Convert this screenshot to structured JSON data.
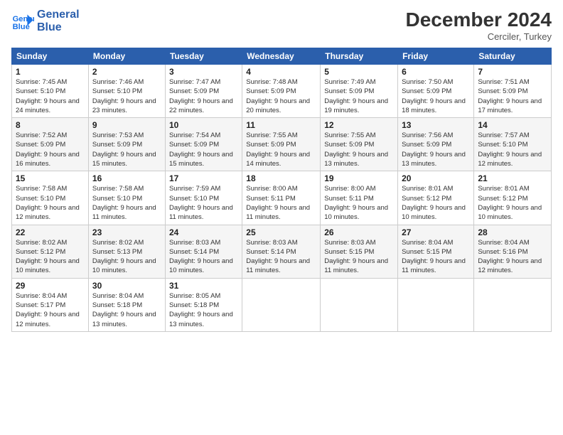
{
  "header": {
    "logo_line1": "General",
    "logo_line2": "Blue",
    "month": "December 2024",
    "location": "Cerciler, Turkey"
  },
  "weekdays": [
    "Sunday",
    "Monday",
    "Tuesday",
    "Wednesday",
    "Thursday",
    "Friday",
    "Saturday"
  ],
  "weeks": [
    [
      {
        "day": "1",
        "sunrise": "Sunrise: 7:45 AM",
        "sunset": "Sunset: 5:10 PM",
        "daylight": "Daylight: 9 hours and 24 minutes."
      },
      {
        "day": "2",
        "sunrise": "Sunrise: 7:46 AM",
        "sunset": "Sunset: 5:10 PM",
        "daylight": "Daylight: 9 hours and 23 minutes."
      },
      {
        "day": "3",
        "sunrise": "Sunrise: 7:47 AM",
        "sunset": "Sunset: 5:09 PM",
        "daylight": "Daylight: 9 hours and 22 minutes."
      },
      {
        "day": "4",
        "sunrise": "Sunrise: 7:48 AM",
        "sunset": "Sunset: 5:09 PM",
        "daylight": "Daylight: 9 hours and 20 minutes."
      },
      {
        "day": "5",
        "sunrise": "Sunrise: 7:49 AM",
        "sunset": "Sunset: 5:09 PM",
        "daylight": "Daylight: 9 hours and 19 minutes."
      },
      {
        "day": "6",
        "sunrise": "Sunrise: 7:50 AM",
        "sunset": "Sunset: 5:09 PM",
        "daylight": "Daylight: 9 hours and 18 minutes."
      },
      {
        "day": "7",
        "sunrise": "Sunrise: 7:51 AM",
        "sunset": "Sunset: 5:09 PM",
        "daylight": "Daylight: 9 hours and 17 minutes."
      }
    ],
    [
      {
        "day": "8",
        "sunrise": "Sunrise: 7:52 AM",
        "sunset": "Sunset: 5:09 PM",
        "daylight": "Daylight: 9 hours and 16 minutes."
      },
      {
        "day": "9",
        "sunrise": "Sunrise: 7:53 AM",
        "sunset": "Sunset: 5:09 PM",
        "daylight": "Daylight: 9 hours and 15 minutes."
      },
      {
        "day": "10",
        "sunrise": "Sunrise: 7:54 AM",
        "sunset": "Sunset: 5:09 PM",
        "daylight": "Daylight: 9 hours and 15 minutes."
      },
      {
        "day": "11",
        "sunrise": "Sunrise: 7:55 AM",
        "sunset": "Sunset: 5:09 PM",
        "daylight": "Daylight: 9 hours and 14 minutes."
      },
      {
        "day": "12",
        "sunrise": "Sunrise: 7:55 AM",
        "sunset": "Sunset: 5:09 PM",
        "daylight": "Daylight: 9 hours and 13 minutes."
      },
      {
        "day": "13",
        "sunrise": "Sunrise: 7:56 AM",
        "sunset": "Sunset: 5:09 PM",
        "daylight": "Daylight: 9 hours and 13 minutes."
      },
      {
        "day": "14",
        "sunrise": "Sunrise: 7:57 AM",
        "sunset": "Sunset: 5:10 PM",
        "daylight": "Daylight: 9 hours and 12 minutes."
      }
    ],
    [
      {
        "day": "15",
        "sunrise": "Sunrise: 7:58 AM",
        "sunset": "Sunset: 5:10 PM",
        "daylight": "Daylight: 9 hours and 12 minutes."
      },
      {
        "day": "16",
        "sunrise": "Sunrise: 7:58 AM",
        "sunset": "Sunset: 5:10 PM",
        "daylight": "Daylight: 9 hours and 11 minutes."
      },
      {
        "day": "17",
        "sunrise": "Sunrise: 7:59 AM",
        "sunset": "Sunset: 5:10 PM",
        "daylight": "Daylight: 9 hours and 11 minutes."
      },
      {
        "day": "18",
        "sunrise": "Sunrise: 8:00 AM",
        "sunset": "Sunset: 5:11 PM",
        "daylight": "Daylight: 9 hours and 11 minutes."
      },
      {
        "day": "19",
        "sunrise": "Sunrise: 8:00 AM",
        "sunset": "Sunset: 5:11 PM",
        "daylight": "Daylight: 9 hours and 10 minutes."
      },
      {
        "day": "20",
        "sunrise": "Sunrise: 8:01 AM",
        "sunset": "Sunset: 5:12 PM",
        "daylight": "Daylight: 9 hours and 10 minutes."
      },
      {
        "day": "21",
        "sunrise": "Sunrise: 8:01 AM",
        "sunset": "Sunset: 5:12 PM",
        "daylight": "Daylight: 9 hours and 10 minutes."
      }
    ],
    [
      {
        "day": "22",
        "sunrise": "Sunrise: 8:02 AM",
        "sunset": "Sunset: 5:12 PM",
        "daylight": "Daylight: 9 hours and 10 minutes."
      },
      {
        "day": "23",
        "sunrise": "Sunrise: 8:02 AM",
        "sunset": "Sunset: 5:13 PM",
        "daylight": "Daylight: 9 hours and 10 minutes."
      },
      {
        "day": "24",
        "sunrise": "Sunrise: 8:03 AM",
        "sunset": "Sunset: 5:14 PM",
        "daylight": "Daylight: 9 hours and 10 minutes."
      },
      {
        "day": "25",
        "sunrise": "Sunrise: 8:03 AM",
        "sunset": "Sunset: 5:14 PM",
        "daylight": "Daylight: 9 hours and 11 minutes."
      },
      {
        "day": "26",
        "sunrise": "Sunrise: 8:03 AM",
        "sunset": "Sunset: 5:15 PM",
        "daylight": "Daylight: 9 hours and 11 minutes."
      },
      {
        "day": "27",
        "sunrise": "Sunrise: 8:04 AM",
        "sunset": "Sunset: 5:15 PM",
        "daylight": "Daylight: 9 hours and 11 minutes."
      },
      {
        "day": "28",
        "sunrise": "Sunrise: 8:04 AM",
        "sunset": "Sunset: 5:16 PM",
        "daylight": "Daylight: 9 hours and 12 minutes."
      }
    ],
    [
      {
        "day": "29",
        "sunrise": "Sunrise: 8:04 AM",
        "sunset": "Sunset: 5:17 PM",
        "daylight": "Daylight: 9 hours and 12 minutes."
      },
      {
        "day": "30",
        "sunrise": "Sunrise: 8:04 AM",
        "sunset": "Sunset: 5:18 PM",
        "daylight": "Daylight: 9 hours and 13 minutes."
      },
      {
        "day": "31",
        "sunrise": "Sunrise: 8:05 AM",
        "sunset": "Sunset: 5:18 PM",
        "daylight": "Daylight: 9 hours and 13 minutes."
      },
      null,
      null,
      null,
      null
    ]
  ]
}
